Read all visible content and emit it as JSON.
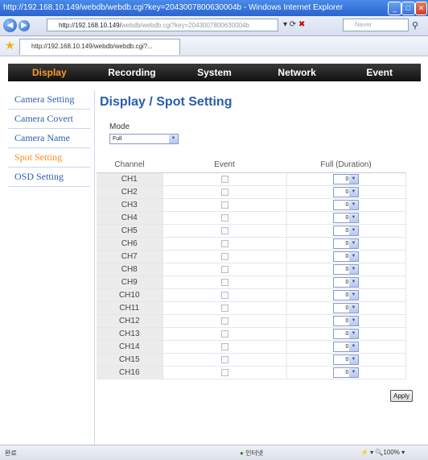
{
  "window": {
    "title": "http://192.168.10.149/webdb/webdb.cgi?key=2043007800630004b - Windows Internet Explorer"
  },
  "address": {
    "host": "http://192.168.10.149/",
    "rest": "webdb/webdb.cgi?key=2043007800630004b",
    "search_placeholder": "Naver"
  },
  "tab": {
    "label": "http://192.168.10.149/webdb/webdb.cgi?..."
  },
  "menu": [
    "Display",
    "Recording",
    "System",
    "Network",
    "Event"
  ],
  "sidebar": [
    "Camera Setting",
    "Camera Covert",
    "Camera Name",
    "Spot Setting",
    "OSD Setting"
  ],
  "page_title": "Display / Spot Setting",
  "mode": {
    "label": "Mode",
    "value": "Full"
  },
  "table": {
    "headers": [
      "Channel",
      "Event",
      "Full (Duration)"
    ],
    "rows": [
      {
        "channel": "CH1",
        "duration": "0"
      },
      {
        "channel": "CH2",
        "duration": "0"
      },
      {
        "channel": "CH3",
        "duration": "0"
      },
      {
        "channel": "CH4",
        "duration": "0"
      },
      {
        "channel": "CH5",
        "duration": "0"
      },
      {
        "channel": "CH6",
        "duration": "0"
      },
      {
        "channel": "CH7",
        "duration": "0"
      },
      {
        "channel": "CH8",
        "duration": "0"
      },
      {
        "channel": "CH9",
        "duration": "0"
      },
      {
        "channel": "CH10",
        "duration": "0"
      },
      {
        "channel": "CH11",
        "duration": "0"
      },
      {
        "channel": "CH12",
        "duration": "0"
      },
      {
        "channel": "CH13",
        "duration": "0"
      },
      {
        "channel": "CH14",
        "duration": "0"
      },
      {
        "channel": "CH15",
        "duration": "0"
      },
      {
        "channel": "CH16",
        "duration": "0"
      }
    ]
  },
  "apply_label": "Apply",
  "status": {
    "left": "완료",
    "zone": "인터넷",
    "zoom": "100%"
  },
  "colors": {
    "accent": "#ff8a1c",
    "link": "#2a5db0",
    "menubar": "#1a1a1a"
  }
}
